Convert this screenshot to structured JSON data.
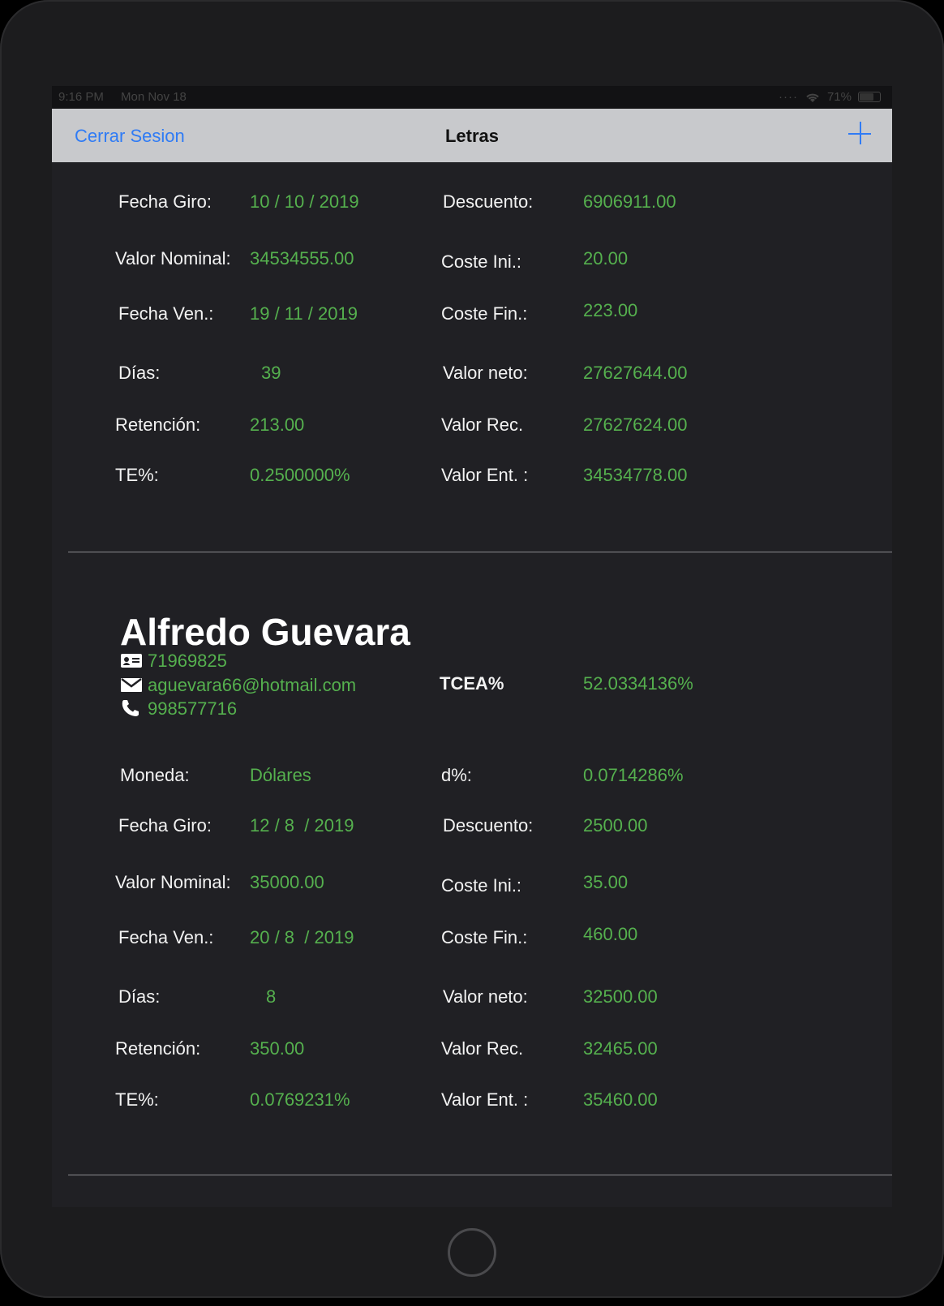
{
  "status_bar": {
    "time": "9:16 PM",
    "date": "Mon Nov 18",
    "battery": "71%",
    "battery_level": 0.71
  },
  "navbar": {
    "left_button": "Cerrar Sesion",
    "title": "Letras",
    "add_icon": "plus-icon"
  },
  "letra1": {
    "fecha_giro_label": "Fecha Giro:",
    "fecha_giro": "10 / 10 / 2019",
    "descuento_label": "Descuento:",
    "descuento": "6906911.00",
    "valor_nominal_label": "Valor Nominal:",
    "valor_nominal": "34534555.00",
    "coste_ini_label": "Coste Ini.:",
    "coste_ini": "20.00",
    "fecha_ven_label": "Fecha Ven.:",
    "fecha_ven": "19 / 11 / 2019",
    "coste_fin_label": "Coste Fin.:",
    "coste_fin": "223.00",
    "dias_label": "Días:",
    "dias": "39",
    "valor_neto_label": "Valor neto:",
    "valor_neto": "27627644.00",
    "retencion_label": "Retención:",
    "retencion": "213.00",
    "valor_rec_label": "Valor Rec.",
    "valor_rec": "27627624.00",
    "te_label": "TE%:",
    "te": "0.2500000%",
    "valor_ent_label": "Valor Ent. :",
    "valor_ent": "34534778.00"
  },
  "letra2": {
    "cliente_nombre": "Alfredo Guevara",
    "dni": "71969825",
    "email": "aguevara66@hotmail.com",
    "telefono": "998577716",
    "tcea_label": "TCEA%",
    "tcea": "52.0334136%",
    "moneda_label": "Moneda:",
    "moneda": "Dólares",
    "d_label": "d%:",
    "d": "0.0714286%",
    "fecha_giro_label": "Fecha Giro:",
    "fecha_giro": "12 / 8  / 2019",
    "descuento_label": "Descuento:",
    "descuento": "2500.00",
    "valor_nominal_label": "Valor Nominal:",
    "valor_nominal": "35000.00",
    "coste_ini_label": "Coste Ini.:",
    "coste_ini": "35.00",
    "fecha_ven_label": "Fecha Ven.:",
    "fecha_ven": "20 / 8  / 2019",
    "coste_fin_label": "Coste Fin.:",
    "coste_fin": "460.00",
    "dias_label": "Días:",
    "dias": "8",
    "valor_neto_label": "Valor neto:",
    "valor_neto": "32500.00",
    "retencion_label": "Retención:",
    "retencion": "350.00",
    "valor_rec_label": "Valor Rec.",
    "valor_rec": "32465.00",
    "te_label": "TE%:",
    "te": "0.0769231%",
    "valor_ent_label": "Valor Ent. :",
    "valor_ent": "35460.00"
  },
  "icons": {
    "id_card": "id-card-icon",
    "email": "envelope-icon",
    "phone": "phone-icon"
  },
  "colors": {
    "value_green": "#55b04e",
    "link_blue": "#2f7bf5",
    "background": "#202024",
    "navbar": "#c8c9cc"
  }
}
